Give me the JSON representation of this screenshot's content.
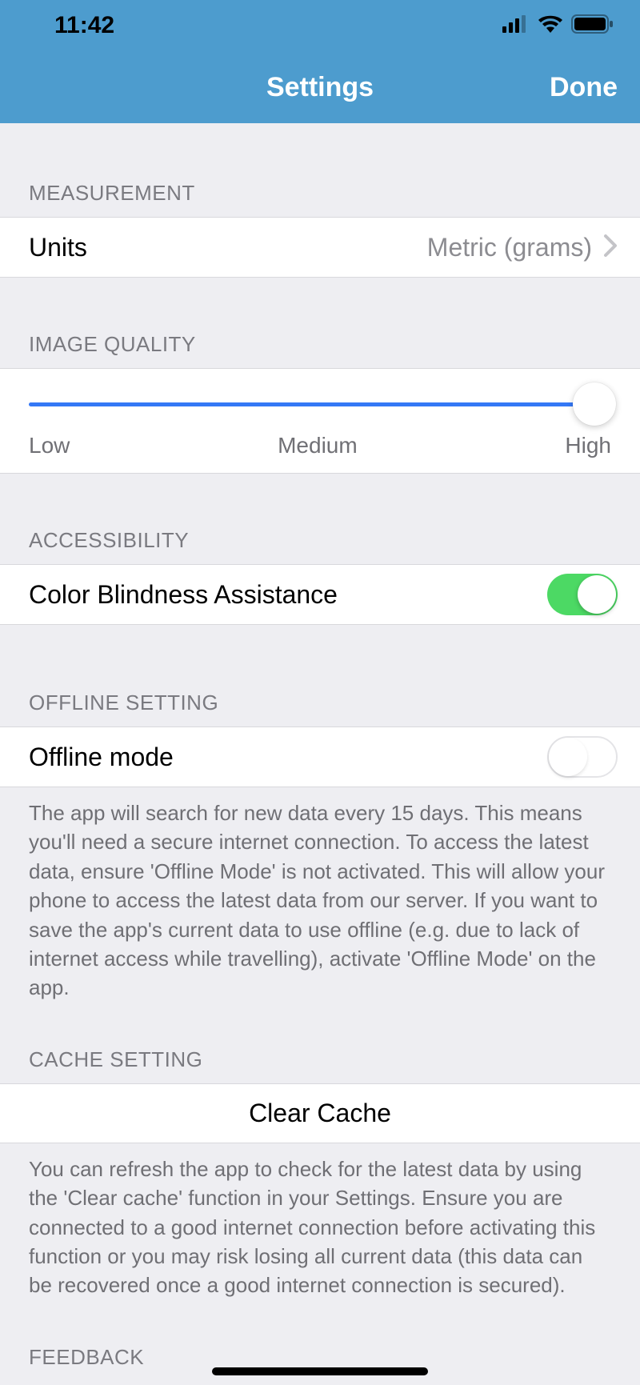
{
  "status": {
    "time": "11:42"
  },
  "nav": {
    "title": "Settings",
    "done": "Done"
  },
  "sections": {
    "measurement": {
      "header": "MEASUREMENT",
      "units_label": "Units",
      "units_value": "Metric (grams)"
    },
    "image_quality": {
      "header": "IMAGE QUALITY",
      "low": "Low",
      "medium": "Medium",
      "high": "High"
    },
    "accessibility": {
      "header": "ACCESSIBILITY",
      "color_blindness_label": "Color Blindness Assistance"
    },
    "offline": {
      "header": "OFFLINE SETTING",
      "offline_label": "Offline mode",
      "footer": "The app will search for new data every 15 days. This means you'll need a secure internet connection. To access the latest data, ensure 'Offline Mode' is not activated. This will allow your phone to access the latest data from our server. If you want to save the app's current data to use offline (e.g. due to lack of internet access while travelling), activate 'Offline Mode' on the app."
    },
    "cache": {
      "header": "CACHE SETTING",
      "clear_label": "Clear Cache",
      "footer": "You can refresh the app to check for the latest data by using the 'Clear cache' function in your Settings. Ensure you are connected to a good internet connection before activating this function or you may risk losing all current data (this data can be recovered once a good internet connection is secured)."
    },
    "feedback": {
      "header": "FEEDBACK"
    }
  }
}
